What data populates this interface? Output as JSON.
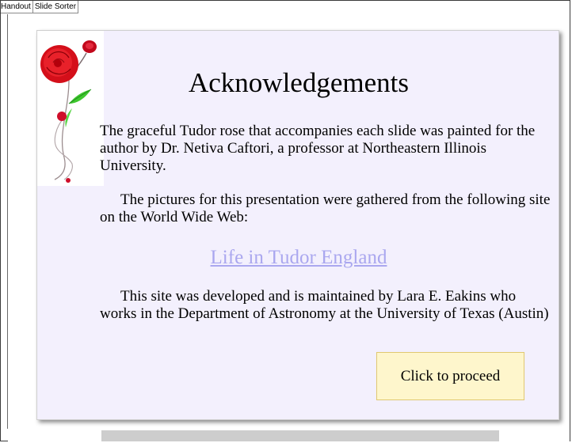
{
  "tabs": [
    {
      "label": "Handout"
    },
    {
      "label": "Slide Sorter"
    }
  ],
  "slide": {
    "title": "Acknowledgements",
    "paragraph1": "The graceful Tudor rose that accompanies each slide was painted for the author by Dr. Netiva Caftori, a professor at Northeastern Illinois University.",
    "paragraph2": "The pictures for this presentation were gathered from the following site on the World Wide Web:",
    "link": "Life in Tudor England",
    "paragraph3": "This site was developed and is maintained by Lara E. Eakins who works in the Department of Astronomy at the University of Texas (Austin)",
    "button": "Click to proceed"
  },
  "colors": {
    "slide_background": "#f3f0fd",
    "link": "#aaa7ef",
    "button_background": "#fef6cc",
    "rose": "#d40f1a"
  },
  "icons": {
    "rose": "tudor-rose-image"
  }
}
